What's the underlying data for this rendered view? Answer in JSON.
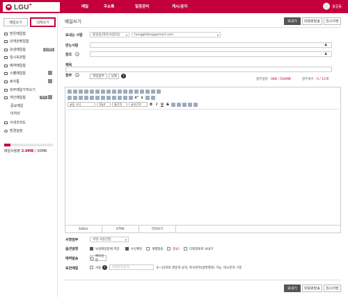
{
  "brand": {
    "logo_text": "LGU",
    "logo_plus": "+",
    "color": "#c4003c"
  },
  "topnav": [
    "메일",
    "주소록",
    "일정관리",
    "게시/공지"
  ],
  "user": {
    "name": "홍길동"
  },
  "sidebar": {
    "compose": "메일쓰기",
    "tome": "내게쓰기",
    "items": [
      {
        "label": "받은메일함",
        "icon": "inbox-icon"
      },
      {
        "label": "내게쓴메일함",
        "icon": "self-mail-icon"
      },
      {
        "label": "보낸메일함",
        "icon": "sent-icon",
        "badge": "수신확인"
      },
      {
        "label": "임시보관함",
        "icon": "draft-icon"
      },
      {
        "label": "예약메일함",
        "icon": "scheduled-icon"
      },
      {
        "label": "스팸메일함",
        "icon": "spam-icon"
      },
      {
        "label": "휴지통",
        "icon": "trash-icon"
      },
      {
        "label": "외부메일가져오기",
        "icon": "external-mail-icon"
      },
      {
        "label": "개인메일함",
        "icon": "personal-folder-icon",
        "badge": "추가"
      },
      {
        "label": "중요메일",
        "sub": true
      },
      {
        "label": "미처리",
        "sub": true
      },
      {
        "label": "사내조직도",
        "icon": "org-chart-icon"
      },
      {
        "label": "환경설정",
        "icon": "settings-icon"
      }
    ],
    "storage": {
      "label": "메일사용량",
      "used": "3.9MB",
      "total": "/ 30MB",
      "fraction": 0.13
    }
  },
  "compose": {
    "title": "메일쓰기",
    "actions": {
      "send": "보내기",
      "send_large": "대용량발송",
      "save_draft": "임시저장"
    },
    "sender_label": "보내는 사람",
    "sender_name": "홍길동/대리/사업1팀",
    "sender_email": "honggildong@email.com",
    "to_label": "받는사람",
    "cc_label": "참조",
    "subject_label": "제목",
    "attach_label": "첨부",
    "attach_btn": "파일첨부",
    "delete_btn": "삭제",
    "attach_size_label": "첨부용량 :",
    "attach_size_value": "0KB / 500MB",
    "attach_count_label": "첨부개수 :",
    "attach_count_value": "0 / 15개",
    "editor": {
      "font": "굴림 고딕",
      "size": "10pt",
      "line_height": "줄간격",
      "letter_spacing": "글자간격",
      "tabs": [
        "Editor",
        "HTML",
        "미리보기"
      ]
    },
    "signature_label": "서명첨부",
    "signature_value": "서명 사용안함",
    "options_label": "옵션설정",
    "options": [
      {
        "label": "보낸메일함에 저장",
        "checked": true
      },
      {
        "label": "수신확인",
        "checked": true
      },
      {
        "label": "개별발송",
        "checked": false
      },
      {
        "label": "중요!",
        "checked": false,
        "red": true
      },
      {
        "label": "다외경로로 보내기",
        "checked": false
      }
    ],
    "schedule_label": "예약발송",
    "schedule_value": "예약설정",
    "secure_label": "보안메일",
    "secure_check": "사용",
    "secure_placeholder": "비밀번호입력",
    "secure_hint": "6~12자의 영문과 숫자, 특수문자(알파벳과) 가능. 대소문자 구분"
  }
}
